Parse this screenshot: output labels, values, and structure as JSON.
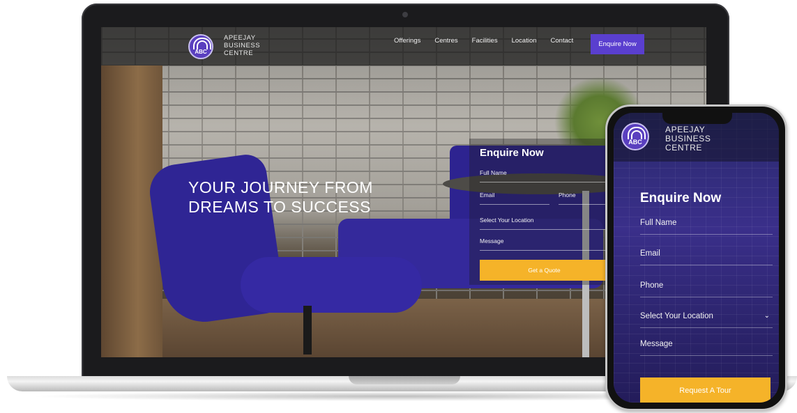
{
  "brand": {
    "logo_abbr": "ABC",
    "name_line1": "APEEJAY",
    "name_line2": "BUSINESS",
    "name_line3": "CENTRE",
    "accent": "#5a3fcf",
    "cta_color": "#f5b329"
  },
  "desktop": {
    "nav": [
      "Offerings",
      "Centres",
      "Facilities",
      "Location",
      "Contact"
    ],
    "enquire_button": "Enquire Now",
    "hero_line1": "YOUR JOURNEY FROM",
    "hero_line2": "DREAMS TO SUCCESS",
    "form": {
      "title": "Enquire Now",
      "full_name": "Full Name",
      "email": "Email",
      "phone": "Phone",
      "location": "Select Your Location",
      "message": "Message",
      "submit": "Get a Quote"
    }
  },
  "mobile": {
    "form": {
      "title": "Enquire Now",
      "full_name": "Full Name",
      "email": "Email",
      "phone": "Phone",
      "location": "Select Your Location",
      "message": "Message",
      "submit": "Request A Tour"
    }
  }
}
